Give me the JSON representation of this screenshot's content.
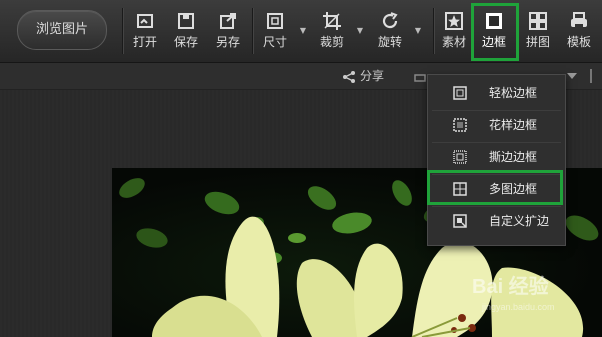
{
  "toolbar": {
    "browse_label": "浏览图片",
    "tools": [
      {
        "name": "open",
        "label": "打开",
        "icon": "open-icon"
      },
      {
        "name": "save",
        "label": "保存",
        "icon": "save-icon"
      },
      {
        "name": "save-as",
        "label": "另存",
        "icon": "save-as-icon"
      },
      {
        "name": "size",
        "label": "尺寸",
        "icon": "resize-icon"
      },
      {
        "name": "crop",
        "label": "裁剪",
        "icon": "crop-icon"
      },
      {
        "name": "rotate",
        "label": "旋转",
        "icon": "rotate-icon"
      },
      {
        "name": "material",
        "label": "素材",
        "icon": "star-icon"
      },
      {
        "name": "border",
        "label": "边框",
        "icon": "border-icon"
      },
      {
        "name": "collage",
        "label": "拼图",
        "icon": "grid-icon"
      },
      {
        "name": "template",
        "label": "模板",
        "icon": "printer-icon"
      }
    ]
  },
  "subbar": {
    "share_label": "分享"
  },
  "border_menu": {
    "items": [
      {
        "label": "轻松边框",
        "icon": "simple-border-icon"
      },
      {
        "label": "花样边框",
        "icon": "pattern-border-icon"
      },
      {
        "label": "撕边边框",
        "icon": "torn-border-icon"
      },
      {
        "label": "多图边框",
        "icon": "multi-border-icon"
      },
      {
        "label": "自定义扩边",
        "icon": "custom-extend-icon"
      }
    ]
  },
  "watermark": {
    "text": "Bai 经验",
    "url": "jingyan.baidu.com"
  },
  "colors": {
    "highlight": "#1fa33a",
    "toolbar_bg": "#2f2f2f",
    "photo_bg": "#060906"
  }
}
